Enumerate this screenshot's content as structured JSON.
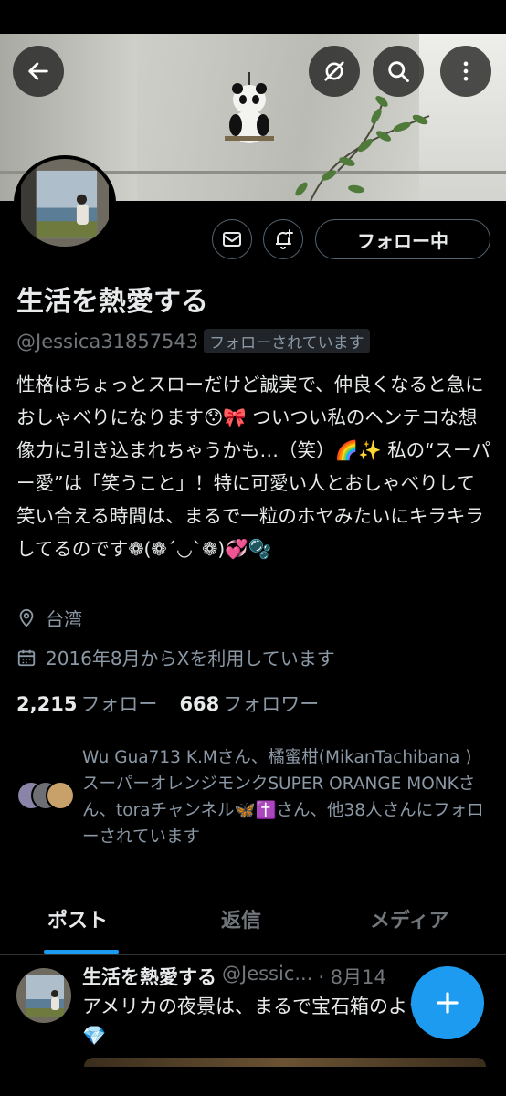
{
  "profile": {
    "display_name": "生活を熱愛する",
    "handle": "@Jessica31857543",
    "follows_you": "フォローされています",
    "bio": "性格はちょっとスローだけど誠実で、仲良くなると急におしゃべりになります😯🎀 ついつい私のヘンテコな想像力に引き込まれちゃうかも…（笑）🌈✨ 私の“スーパー愛”は「笑うこと」！特に可愛い人とおしゃべりして笑い合える時間は、まるで一粒のホヤみたいにキラキラしてるのです❁(❁´◡`❁)💞🫧",
    "location": "台湾",
    "joined": "2016年8月からXを利用しています",
    "following_count": "2,215",
    "following_label": "フォロー",
    "followers_count": "668",
    "followers_label": "フォロワー",
    "known_followers": "Wu Gua713 K.Mさん、橘蜜柑(MikanTachibana )スーパーオレンジモンクSUPER ORANGE MONKさん、toraチャンネル🦋✝️さん、他38人さんにフォローされています"
  },
  "actions": {
    "follow_button": "フォロー中"
  },
  "icons": {
    "back": "back-arrow-icon",
    "grok": "grok-icon",
    "search": "search-icon",
    "more": "more-vertical-icon",
    "message": "envelope-icon",
    "notify": "bell-plus-icon",
    "location": "location-pin-icon",
    "calendar": "calendar-icon",
    "compose": "plus-icon"
  },
  "tabs": [
    {
      "label": "ポスト",
      "active": true
    },
    {
      "label": "返信",
      "active": false
    },
    {
      "label": "メディア",
      "active": false
    }
  ],
  "post": {
    "author_name": "生活を熱愛する",
    "author_handle": "@Jessic...",
    "date": "· 8月14",
    "text": "アメリカの夜景は、まるで宝石箱のよう🌃💎"
  },
  "colors": {
    "background": "#000000",
    "accent": "#1d9bf0",
    "secondary_text": "#71767b",
    "primary_text": "#e7e9ea"
  }
}
